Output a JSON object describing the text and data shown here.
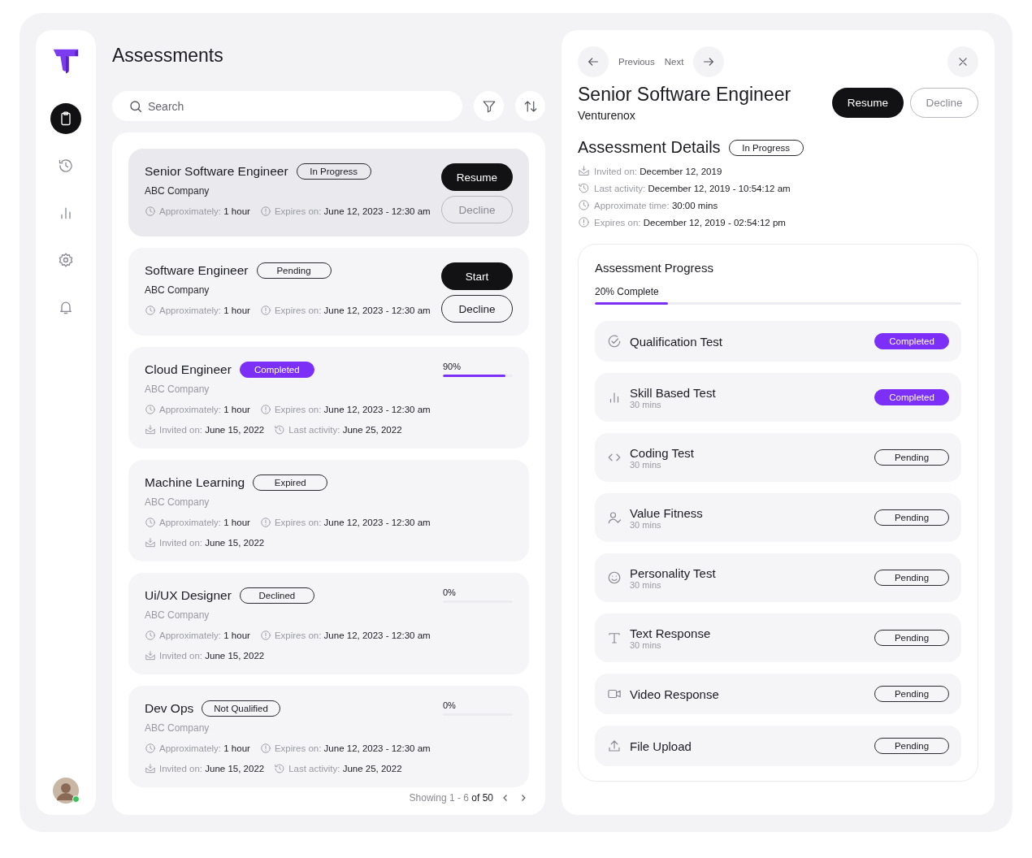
{
  "sidebar": {
    "items": [
      {
        "kind": "clipboard",
        "selected": true
      },
      {
        "kind": "history",
        "selected": false
      },
      {
        "kind": "chart",
        "selected": false
      },
      {
        "kind": "gear",
        "selected": false
      },
      {
        "kind": "bell",
        "selected": false
      }
    ],
    "user": {
      "online": true
    }
  },
  "page": {
    "title": "Assessments"
  },
  "search": {
    "placeholder": "Search"
  },
  "assessments": [
    {
      "title": "Senior Software Engineer",
      "status": {
        "label": "In Progress",
        "kind": "outline"
      },
      "company": "ABC Company",
      "selected": true,
      "kind": "actions",
      "primary": "Resume",
      "secondary": {
        "label": "Decline",
        "disabled": true
      },
      "meta": [
        [
          {
            "kind": "clock",
            "label": "Approximately:",
            "value": "1 hour"
          },
          {
            "kind": "alert",
            "label": "Expires on:",
            "value": "June 12, 2023 - 12:30 am"
          }
        ]
      ]
    },
    {
      "title": "Software Engineer",
      "status": {
        "label": "Pending",
        "kind": "outline"
      },
      "company": "ABC Company",
      "selected": false,
      "kind": "actions",
      "primary": "Start",
      "secondary": {
        "label": "Decline",
        "disabled": false
      },
      "meta": [
        [
          {
            "kind": "clock",
            "label": "Approximately:",
            "value": "1 hour"
          },
          {
            "kind": "alert",
            "label": "Expires on:",
            "value": "June 12, 2023 - 12:30 am"
          }
        ]
      ]
    },
    {
      "title": "Cloud Engineer",
      "status": {
        "label": "Completed",
        "kind": "filled"
      },
      "company": "ABC Company",
      "selected": false,
      "kind": "progress",
      "percent": "90%",
      "level": 0.9,
      "meta": [
        [
          {
            "kind": "clock",
            "label": "Approximately:",
            "value": "1 hour"
          },
          {
            "kind": "alert",
            "label": "Expires on:",
            "value": "June 12, 2023 - 12:30 am"
          }
        ],
        [
          {
            "kind": "inbox",
            "label": "Invited on:",
            "value": "June 15, 2022"
          },
          {
            "kind": "history",
            "label": "Last activity:",
            "value": "June 25, 2022"
          }
        ]
      ]
    },
    {
      "title": "Machine Learning",
      "status": {
        "label": "Expired",
        "kind": "outline"
      },
      "company": "ABC Company",
      "selected": false,
      "kind": "plain",
      "meta": [
        [
          {
            "kind": "clock",
            "label": "Approximately:",
            "value": "1 hour"
          },
          {
            "kind": "alert",
            "label": "Expires on:",
            "value": "June 12, 2023 - 12:30 am"
          }
        ],
        [
          {
            "kind": "inbox",
            "label": "Invited on:",
            "value": "June 15, 2022"
          }
        ]
      ]
    },
    {
      "title": "Ui/UX Designer",
      "status": {
        "label": "Declined",
        "kind": "outline"
      },
      "company": "ABC Company",
      "selected": false,
      "kind": "progress",
      "percent": "0%",
      "meta": [
        [
          {
            "kind": "clock",
            "label": "Approximately:",
            "value": "1 hour"
          },
          {
            "kind": "alert",
            "label": "Expires on:",
            "value": "June 12, 2023 - 12:30 am"
          }
        ],
        [
          {
            "kind": "inbox",
            "label": "Invited on:",
            "value": "June 15, 2022"
          }
        ]
      ]
    },
    {
      "title": "Dev Ops",
      "status": {
        "label": "Not Qualified",
        "kind": "outline"
      },
      "company": "ABC Company",
      "selected": false,
      "kind": "progress",
      "percent": "0%",
      "meta": [
        [
          {
            "kind": "clock",
            "label": "Approximately:",
            "value": "1 hour"
          },
          {
            "kind": "alert",
            "label": "Expires on:",
            "value": "June 12, 2023 - 12:30 am"
          }
        ],
        [
          {
            "kind": "inbox",
            "label": "Invited on:",
            "value": "June 15, 2022"
          },
          {
            "kind": "history",
            "label": "Last activity:",
            "value": "June 25, 2022"
          }
        ]
      ]
    }
  ],
  "pagination": {
    "range": "Showing 1 - 6",
    "total": "of 50"
  },
  "detail": {
    "previous": "Previous",
    "next": "Next",
    "title": "Senior Software Engineer",
    "company": "Venturenox",
    "primary": "Resume",
    "secondary": "Decline",
    "section_title": "Assessment Details",
    "status": "In Progress",
    "info": [
      {
        "kind": "inbox",
        "label": "Invited on:",
        "value": "December 12, 2019"
      },
      {
        "kind": "history",
        "label": "Last activity:",
        "value": "December 12, 2019 - 10:54:12 am"
      },
      {
        "kind": "clock",
        "label": "Approximate time:",
        "value": "30:00 mins"
      },
      {
        "kind": "alert",
        "label": "Expires on:",
        "value": "December 12, 2019 - 02:54:12 pm"
      }
    ],
    "progress": {
      "title": "Assessment Progress",
      "label": "20% Complete",
      "level": 0.2
    },
    "tests": [
      {
        "kind": "check",
        "name": "Qualification Test",
        "status": {
          "label": "Completed",
          "kind": "filled"
        }
      },
      {
        "kind": "chart",
        "name": "Skill Based Test",
        "duration": "30 mins",
        "status": {
          "label": "Completed",
          "kind": "filled"
        }
      },
      {
        "kind": "code",
        "name": "Coding Test",
        "duration": "30 mins",
        "status": {
          "label": "Pending",
          "kind": "outline"
        }
      },
      {
        "kind": "user",
        "name": "Value Fitness",
        "duration": "30 mins",
        "status": {
          "label": "Pending",
          "kind": "outline"
        }
      },
      {
        "kind": "smile",
        "name": "Personality Test",
        "duration": "30 mins",
        "status": {
          "label": "Pending",
          "kind": "outline"
        }
      },
      {
        "kind": "text",
        "name": "Text Response",
        "duration": "30 mins",
        "status": {
          "label": "Pending",
          "kind": "outline"
        }
      },
      {
        "kind": "video",
        "name": "Video Response",
        "status": {
          "label": "Pending",
          "kind": "outline"
        }
      },
      {
        "kind": "upload",
        "name": "File Upload",
        "status": {
          "label": "Pending",
          "kind": "outline"
        }
      }
    ]
  }
}
